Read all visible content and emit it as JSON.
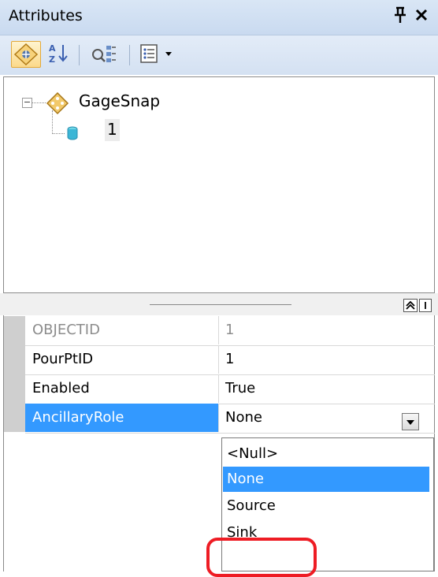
{
  "window": {
    "title": "Attributes",
    "pin_glyph": "⨁",
    "close_glyph": "✕"
  },
  "toolbar": {
    "buttons": [
      {
        "name": "list-by-layer",
        "icon": "layer-diamond-icon",
        "active": true
      },
      {
        "name": "sort",
        "icon": "sort-az-icon"
      },
      {
        "name": "select",
        "icon": "select-features-icon"
      },
      {
        "name": "options",
        "icon": "options-menu-icon"
      }
    ]
  },
  "tree": {
    "expander_glyph": "−",
    "layer": {
      "label": "GageSnap",
      "icon": "point-layer-icon"
    },
    "features": [
      {
        "label": "1",
        "icon": "feature-cylinder-icon"
      }
    ]
  },
  "grid": {
    "rows": [
      {
        "name": "OBJECTID",
        "value": "1",
        "readonly": true
      },
      {
        "name": "PourPtID",
        "value": "1"
      },
      {
        "name": "Enabled",
        "value": "True"
      },
      {
        "name": "AncillaryRole",
        "value": "None",
        "selected": true
      }
    ]
  },
  "dropdown": {
    "options": [
      "<Null>",
      "None",
      "Source",
      "Sink"
    ],
    "selected": "None",
    "highlighted_annotation": "Sink"
  },
  "colors": {
    "selection": "#3399ff",
    "annotation_red": "#ee1c24",
    "titlebar": "#d9e6f5"
  }
}
